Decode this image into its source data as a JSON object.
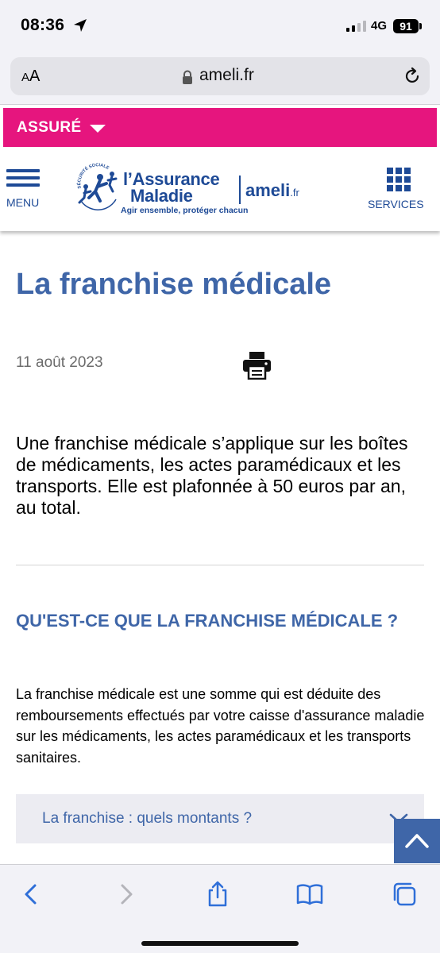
{
  "status_bar": {
    "time": "08:36",
    "network": "4G",
    "battery": "91",
    "icons": [
      "location-arrow-icon",
      "signal-icon",
      "battery-icon"
    ]
  },
  "browser": {
    "text_size_label": "AA",
    "url": "ameli.fr",
    "icons": [
      "lock-icon",
      "reload-icon"
    ]
  },
  "assure_bar": {
    "label": "ASSURÉ",
    "color": "#e6157e"
  },
  "header": {
    "menu_label": "MENU",
    "logo_line1": "l’Assurance",
    "logo_line2": "Maladie",
    "logo_tagline": "Agir ensemble, protéger chacun",
    "logo_seal_text": "SÉCURITÉ SOCIALE",
    "ameli_label": "ameli",
    "ameli_suffix": ".fr",
    "services_label": "SERVICES",
    "brand_color": "#1e4a96"
  },
  "article": {
    "title": "La franchise médicale",
    "date": "11 août 2023",
    "intro": "Une franchise médicale s’applique sur les boîtes de médicaments, les actes paramédicaux et les transports. Elle est plafonnée à 50 euros par an, au total.",
    "section_title": "QU'EST-CE QUE LA FRANCHISE MÉDICALE ?",
    "section_text": "La franchise médicale est une somme qui est déduite des remboursements effectués par votre caisse d'assurance maladie sur les médicaments, les actes paramédicaux et les transports sanitaires.",
    "accordion_label": "La franchise : quels montants ?",
    "title_color": "#3f66a8"
  },
  "toolbar": {
    "icons": [
      "back-icon",
      "forward-icon",
      "share-icon",
      "bookmarks-icon",
      "tabs-icon"
    ]
  }
}
